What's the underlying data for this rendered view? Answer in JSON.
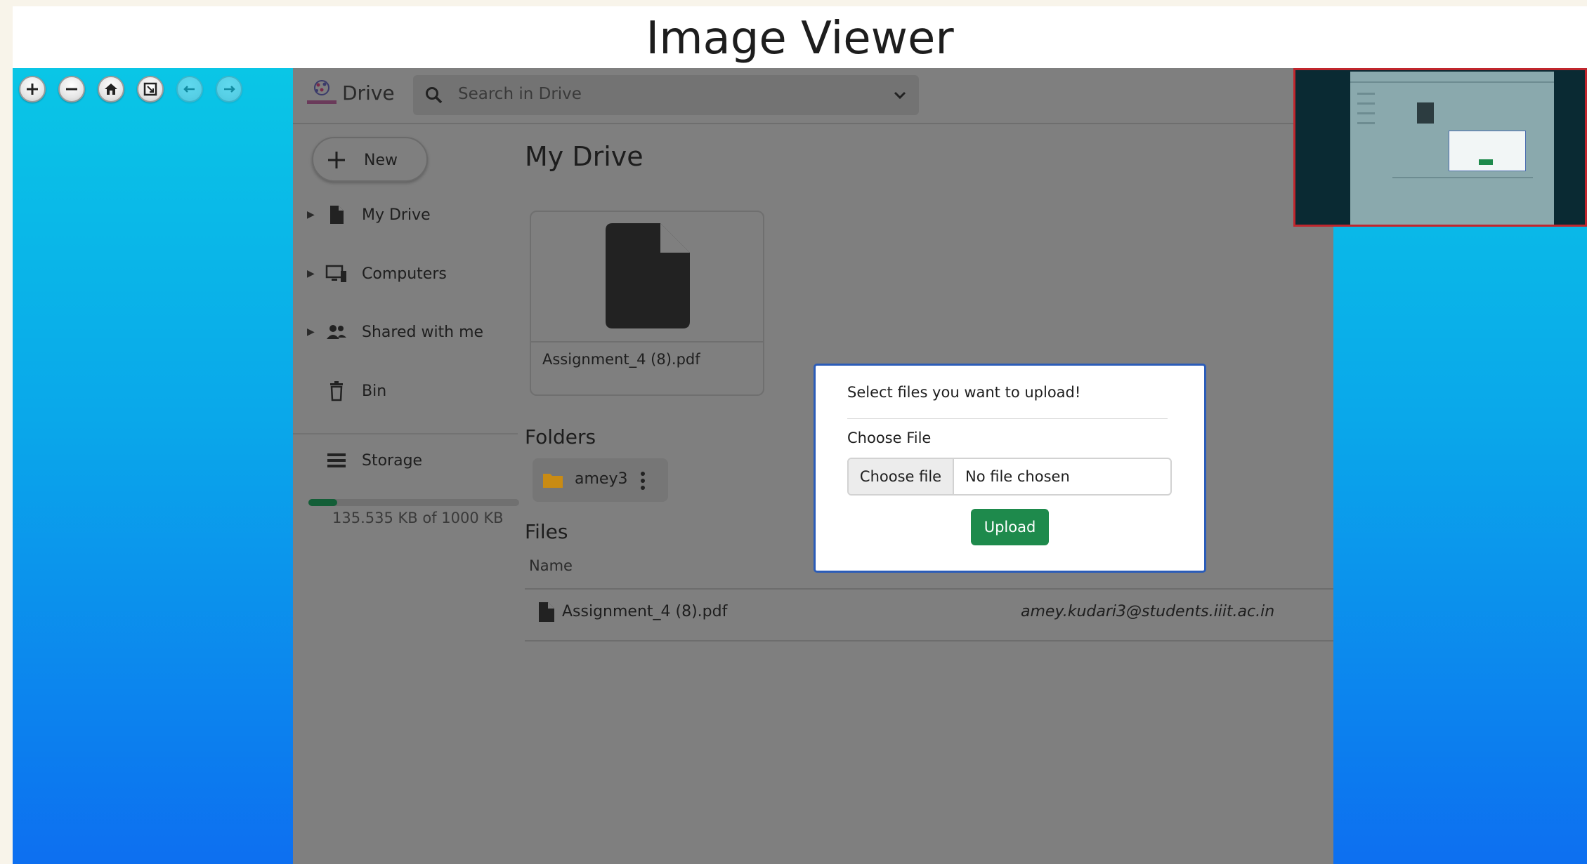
{
  "viewer": {
    "title": "Image Viewer",
    "toolbar": [
      {
        "name": "zoom-in-icon",
        "glyph": "+"
      },
      {
        "name": "zoom-out-icon",
        "glyph": "−"
      },
      {
        "name": "home-icon",
        "glyph": ""
      },
      {
        "name": "fullscreen-icon",
        "glyph": ""
      },
      {
        "name": "previous-icon",
        "glyph": ""
      },
      {
        "name": "next-icon",
        "glyph": ""
      }
    ]
  },
  "drive": {
    "brand": "Drive",
    "search": {
      "placeholder": "Search in Drive"
    },
    "new_label": "New",
    "nav": [
      {
        "label": "My Drive",
        "icon": "file-icon"
      },
      {
        "label": "Computers",
        "icon": "computer-icon"
      },
      {
        "label": "Shared with me",
        "icon": "people-icon"
      },
      {
        "label": "Bin",
        "icon": "trash-icon"
      }
    ],
    "storage": {
      "label": "Storage",
      "text": "135.535 KB of 1000 KB",
      "fraction": 0.135535
    },
    "page_title": "My Drive",
    "recent_file": {
      "name": "Assignment_4 (8).pdf"
    },
    "folders_title": "Folders",
    "folders": [
      {
        "name": "amey3"
      }
    ],
    "files_title": "Files",
    "files_columns": {
      "name": "Name"
    },
    "files": [
      {
        "name": "Assignment_4 (8).pdf",
        "owner": "amey.kudari3@students.iiit.ac.in"
      }
    ],
    "modal": {
      "title": "Select files you want to upload!",
      "label": "Choose File",
      "choose_button": "Choose file",
      "no_file_text": "No file chosen",
      "upload_button": "Upload"
    }
  },
  "colors": {
    "upload_green": "#1e8a4c",
    "modal_border": "#2b5cb8",
    "storage_fill": "#135e37",
    "folder_yellow": "#c98b13",
    "navigator_border": "#c0262d"
  }
}
